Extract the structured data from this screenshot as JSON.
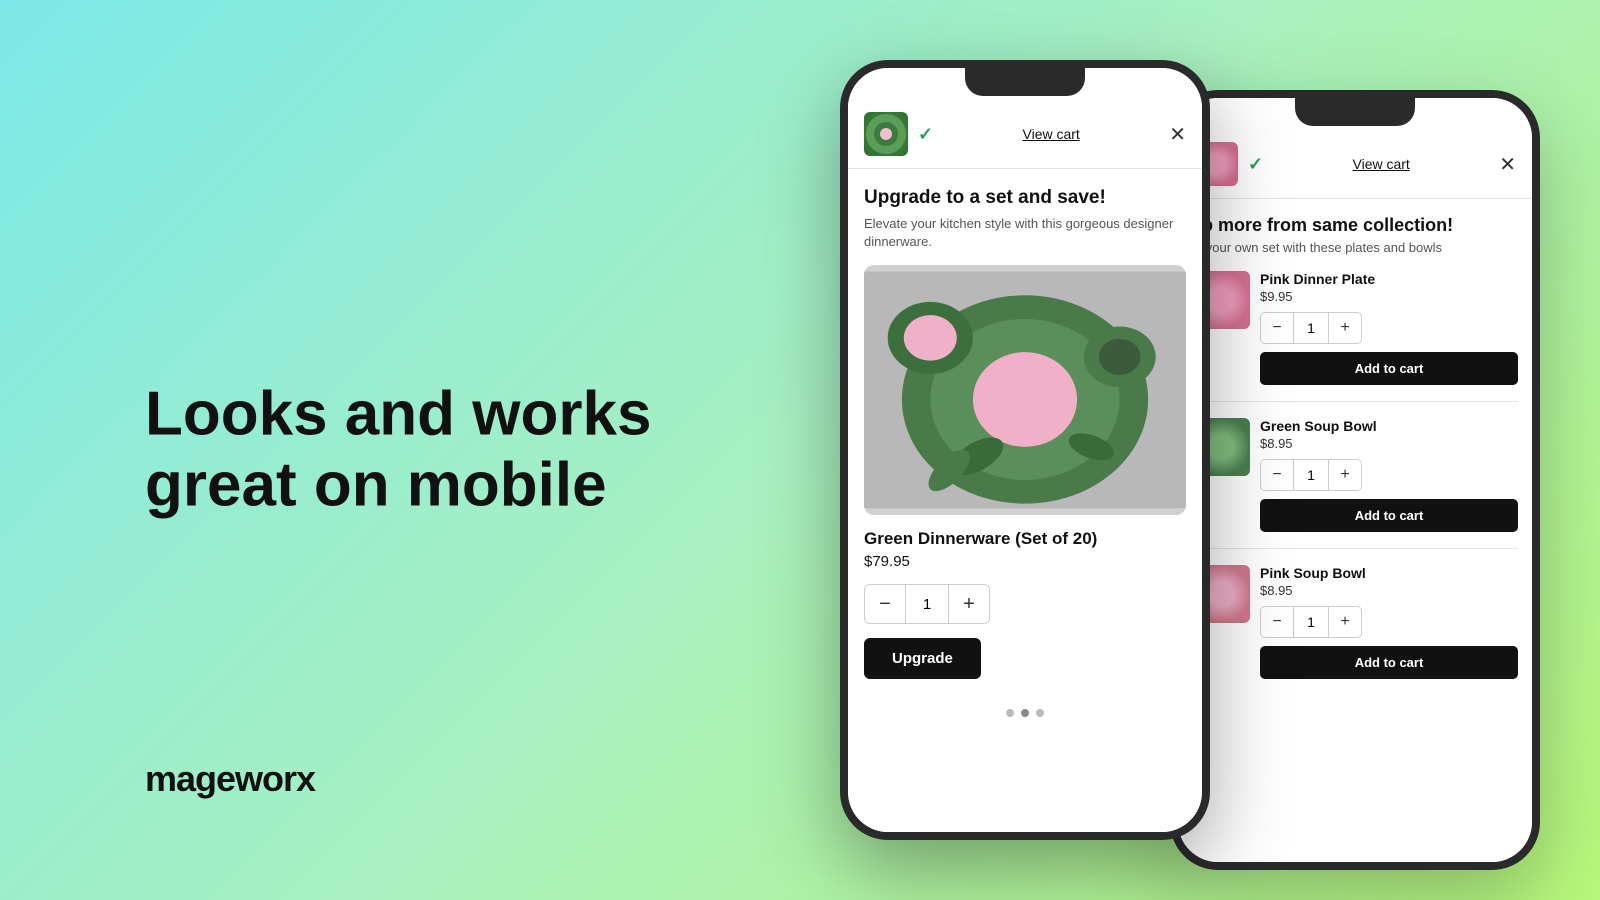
{
  "background": {
    "gradient_start": "#7de8e8",
    "gradient_end": "#b8f87a"
  },
  "left": {
    "headline_line1": "Looks and works",
    "headline_line2": "great on mobile",
    "brand": "mageworx"
  },
  "phone1": {
    "header": {
      "checkmark": "✓",
      "view_cart": "View cart",
      "close": "✕"
    },
    "body": {
      "upgrade_title": "Upgrade to a set and save!",
      "upgrade_desc": "Elevate your kitchen style with this gorgeous designer dinnerware.",
      "product_name": "Green Dinnerware (Set of 20)",
      "product_price": "$79.95",
      "qty": "1",
      "upgrade_btn": "Upgrade"
    },
    "dots": [
      {
        "active": false
      },
      {
        "active": true
      },
      {
        "active": false
      }
    ]
  },
  "phone2": {
    "header": {
      "checkmark": "✓",
      "view_cart": "View cart",
      "close": "✕"
    },
    "body": {
      "collection_title": "ab more from same collection!",
      "collection_desc": "ld your own set with these plates and bowls",
      "products": [
        {
          "name": "Pink Dinner Plate",
          "price": "$9.95",
          "qty": "1",
          "add_to_cart": "Add to cart"
        },
        {
          "name": "Green Soup Bowl",
          "price": "$8.95",
          "qty": "1",
          "add_to_cart": "Add to cart"
        },
        {
          "name": "Pink Soup Bowl",
          "price": "$8.95",
          "qty": "1",
          "add_to_cart": "Add to cart"
        }
      ]
    }
  }
}
